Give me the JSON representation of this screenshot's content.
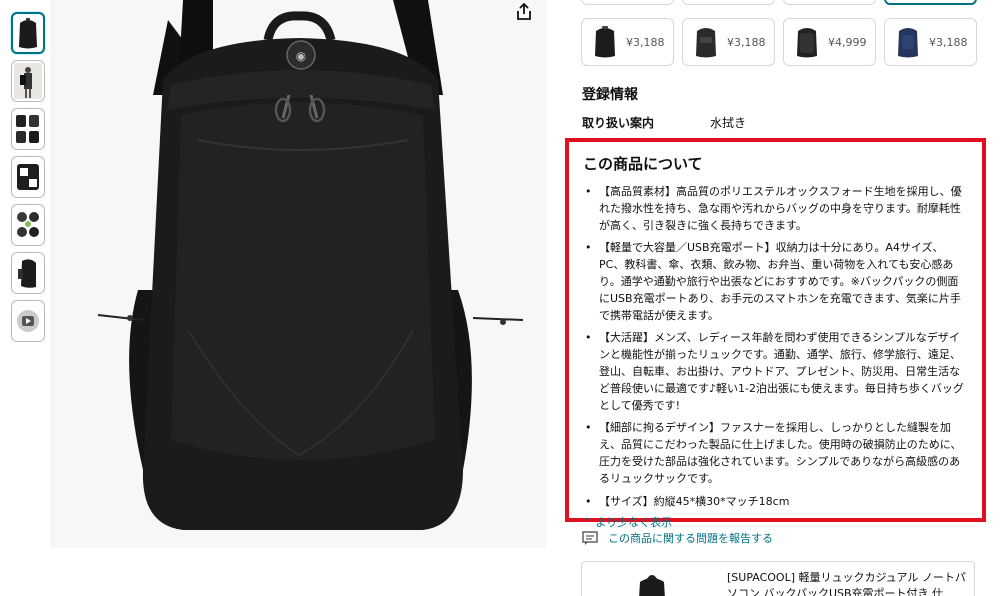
{
  "thumbnails": [
    {
      "icon": "backpack-front-thumbnail",
      "selected": true
    },
    {
      "icon": "model-wearing-thumbnail",
      "selected": false
    },
    {
      "icon": "backpack-detail-thumbnail",
      "selected": false
    },
    {
      "icon": "backpack-pockets-thumbnail",
      "selected": false
    },
    {
      "icon": "backpack-features-thumbnail",
      "selected": false
    },
    {
      "icon": "backpack-side-thumbnail",
      "selected": false
    },
    {
      "icon": "video-thumbnail",
      "selected": false
    }
  ],
  "share": {
    "icon": "share-icon"
  },
  "variants": [
    {
      "price": "¥3,188",
      "color": "#1c1c1c"
    },
    {
      "price": "¥3,188",
      "color": "#2a2a2a"
    },
    {
      "price": "¥4,999",
      "color": "#222222"
    },
    {
      "price": "¥3,188",
      "color": "#26355e"
    }
  ],
  "registration": {
    "title": "登録情報",
    "handling_label": "取り扱い案内",
    "handling_value": "水拭き"
  },
  "about": {
    "title": "この商品について",
    "bullets": [
      "【高品質素材】高品質のポリエステルオックスフォード生地を採用し、優れた撥水性を持ち、急な雨や汚れからバッグの中身を守ります。耐摩耗性が高く、引き裂きに強く長持ちできます。",
      "【軽量で大容量／USB充電ポート】収納力は十分にあり。A4サイズ、PC、教科書、傘、衣類、飲み物、お弁当、重い荷物を入れても安心感あり。通学や通勤や旅行や出張などにおすすめです。※バックパックの側面にUSB充電ポートあり、お手元のスマトホンを充電できます、気楽に片手で携帯電話が使えます。",
      "【大活躍】メンズ、レディース年齢を問わず使用できるシンプルなデザインと機能性が揃ったリュックです。通勤、通学、旅行、修学旅行、遠足、登山、自転車、お出掛け、アウトドア、プレゼント、防災用、日常生活など普段使いに最適です♪軽い1-2泊出張にも使えます。毎日持ち歩くバッグとして優秀です!",
      "【細部に拘るデザイン】ファスナーを採用し、しっかりとした縫製を加え、品質にこだわった製品に仕上げました。使用時の破損防止のために、圧力を受けた部品は強化されています。シンプルでありながら高級感のあるリュックサックです。",
      "【サイズ】約縦45*横30*マッチ18cm"
    ],
    "show_less": "より少なく表示"
  },
  "report": {
    "label": "この商品に関する問題を報告する",
    "icon": "report-icon"
  },
  "related": {
    "title": "[SUPACOOL] 軽量リュックカジュアル ノートパソコン バックパックUSB充電ポート付き 仕"
  },
  "colors": {
    "highlight": "#e0101e",
    "link": "#007185",
    "selected_border": "#007185"
  }
}
